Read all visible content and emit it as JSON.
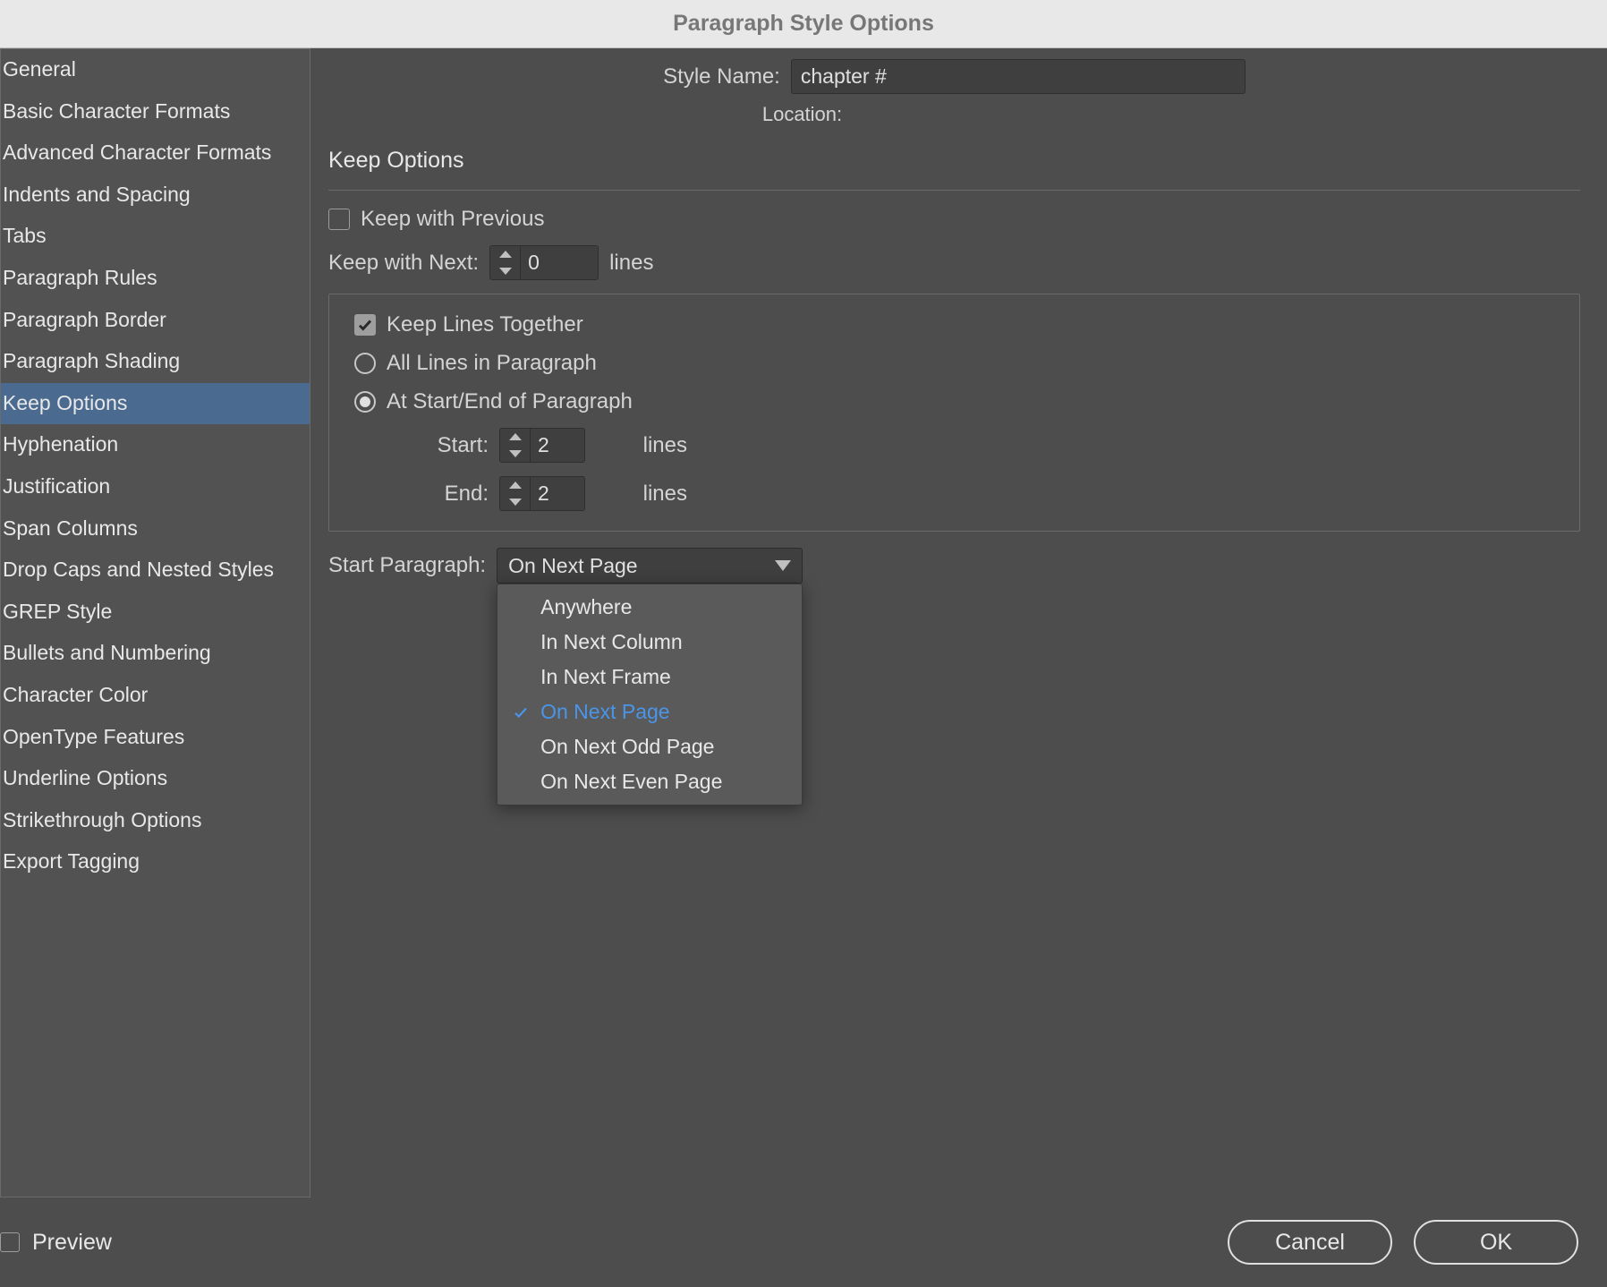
{
  "window": {
    "title": "Paragraph Style Options"
  },
  "sidebar": {
    "items": [
      "General",
      "Basic Character Formats",
      "Advanced Character Formats",
      "Indents and Spacing",
      "Tabs",
      "Paragraph Rules",
      "Paragraph Border",
      "Paragraph Shading",
      "Keep Options",
      "Hyphenation",
      "Justification",
      "Span Columns",
      "Drop Caps and Nested Styles",
      "GREP Style",
      "Bullets and Numbering",
      "Character Color",
      "OpenType Features",
      "Underline Options",
      "Strikethrough Options",
      "Export Tagging"
    ],
    "selected_index": 8
  },
  "header": {
    "style_name_label": "Style Name:",
    "style_name_value": "chapter #",
    "location_label": "Location:"
  },
  "section": {
    "title": "Keep Options",
    "keep_with_previous": {
      "label": "Keep with Previous",
      "checked": false
    },
    "keep_with_next": {
      "label": "Keep with Next:",
      "value": "0",
      "unit": "lines"
    },
    "keep_lines_together": {
      "label": "Keep Lines Together",
      "checked": true
    },
    "all_lines": {
      "label": "All Lines in Paragraph",
      "selected": false
    },
    "start_end": {
      "label": "At Start/End of Paragraph",
      "selected": true
    },
    "start": {
      "label": "Start:",
      "value": "2",
      "unit": "lines"
    },
    "end": {
      "label": "End:",
      "value": "2",
      "unit": "lines"
    },
    "start_paragraph": {
      "label": "Start Paragraph:",
      "value": "On Next Page",
      "options": [
        "Anywhere",
        "In Next Column",
        "In Next Frame",
        "On Next Page",
        "On Next Odd Page",
        "On Next Even Page"
      ],
      "selected_index": 3
    }
  },
  "footer": {
    "preview": {
      "label": "Preview",
      "checked": false
    },
    "cancel": "Cancel",
    "ok": "OK"
  }
}
